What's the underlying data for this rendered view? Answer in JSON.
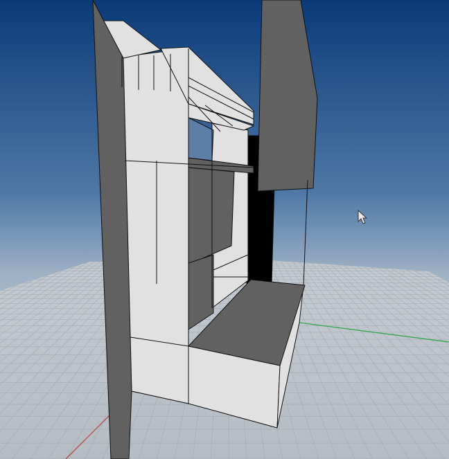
{
  "viewport": {
    "background_top_color": "#0b3a78",
    "background_bottom_color": "#c9d4de",
    "ground_color": "#b9bfc6",
    "grid_line_color": "#a4abb3",
    "x_axis_color": "#b84a4a",
    "y_axis_color": "#2fa84a",
    "model_light_face_color": "#e1e1e1",
    "model_dark_face_color": "#616161",
    "model_shadow_face_color": "#000000",
    "edge_color": "#111111"
  },
  "cursor": {
    "icon": "arrow-pointer-icon"
  }
}
